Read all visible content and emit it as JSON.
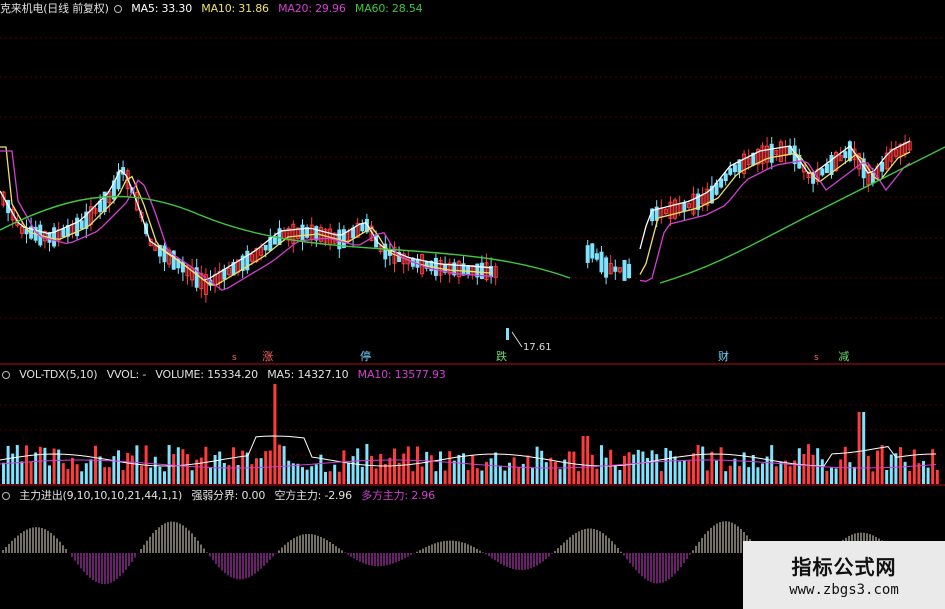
{
  "price_panel": {
    "title": "克来机电(日线 前复权)",
    "ma5_label": "MA5: 33.30",
    "ma10_label": "MA10: 31.86",
    "ma20_label": "MA20: 29.96",
    "ma60_label": "MA60: 28.54",
    "low_label": "17.61",
    "colors": {
      "up": "#ff3b3b",
      "down": "#7fe3ff",
      "ma5": "#ffffff",
      "ma10": "#f0e06a",
      "ma20": "#d040d0",
      "ma60": "#3fc73f"
    }
  },
  "markers": [
    {
      "char": "涨",
      "color": "#ff6060",
      "prefix": "s"
    },
    {
      "char": "停",
      "color": "#6fd6ff",
      "prefix": ""
    },
    {
      "char": "跌",
      "color": "#6fd86f",
      "prefix": ""
    },
    {
      "char": "财",
      "color": "#6fd6ff",
      "prefix": ""
    },
    {
      "char": "减",
      "color": "#6fd86f",
      "prefix": "s"
    }
  ],
  "volume_panel": {
    "name_label": "VOL-TDX(5,10)",
    "vvol_label": "VVOL: -",
    "volume_label": "VOLUME: 15334.20",
    "ma5_label": "MA5: 14327.10",
    "ma10_label": "MA10: 13577.93"
  },
  "flow_panel": {
    "name_label": "主力进出(9,10,10,10,21,44,1,1)",
    "strength_label": "强弱分界: 0.00",
    "bear_label": "空方主力: -2.96",
    "bull_label": "多方主力: 2.96"
  },
  "watermark": {
    "line1": "指标公式网",
    "line2": "www.zbgs3.com"
  }
}
